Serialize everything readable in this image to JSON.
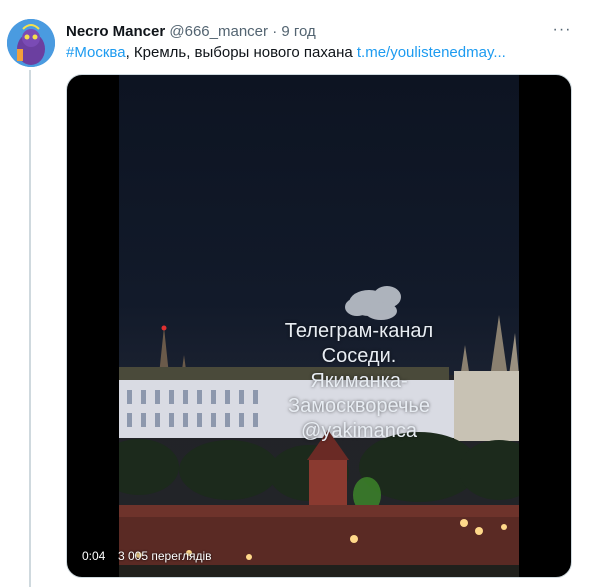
{
  "tweet": {
    "display_name": "Necro Mancer",
    "handle": "@666_mancer",
    "separator": "·",
    "time": "9 год",
    "more_icon": "more-dots-icon",
    "text": {
      "hashtag": "#Москва",
      "body": ", Кремль, выборы нового пахана ",
      "link": "t.me/youlistenedmay..."
    }
  },
  "media": {
    "overlay_lines": [
      "Телеграм-канал",
      "Соседи.",
      "Якиманка-",
      "Замоскворечье",
      "@yakimanca"
    ],
    "video_time": "0:04",
    "video_views": "3 005 переглядів"
  },
  "colors": {
    "link": "#1d9bf0",
    "secondary_text": "#536471",
    "thread_line": "#cfd9de"
  }
}
